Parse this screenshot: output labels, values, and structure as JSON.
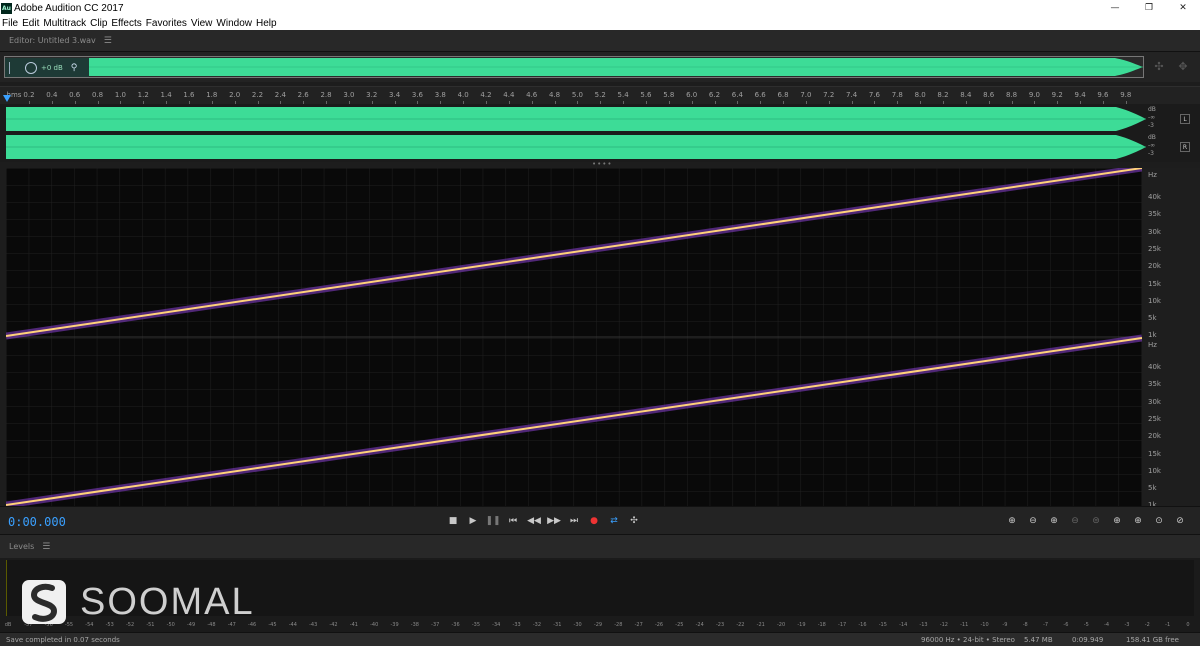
{
  "window": {
    "title": "Adobe Audition CC 2017",
    "app_icon": "Au",
    "controls": {
      "minimize": "—",
      "maximize": "❐",
      "close": "✕"
    }
  },
  "menu": [
    "File",
    "Edit",
    "Multitrack",
    "Clip",
    "Effects",
    "Favorites",
    "View",
    "Window",
    "Help"
  ],
  "editor": {
    "title": "Editor: Untitled 3.wav"
  },
  "hud": {
    "gain": "+0 dB"
  },
  "ruler": {
    "unit": "hms",
    "labels": [
      "0.2",
      "0.4",
      "0.6",
      "0.8",
      "1.0",
      "1.2",
      "1.4",
      "1.6",
      "1.8",
      "2.0",
      "2.2",
      "2.4",
      "2.6",
      "2.8",
      "3.0",
      "3.2",
      "3.4",
      "3.6",
      "3.8",
      "4.0",
      "4.2",
      "4.4",
      "4.6",
      "4.8",
      "5.0",
      "5.2",
      "5.4",
      "5.6",
      "5.8",
      "6.0",
      "6.2",
      "6.4",
      "6.6",
      "6.8",
      "7.0",
      "7.2",
      "7.4",
      "7.6",
      "7.8",
      "8.0",
      "8.2",
      "8.4",
      "8.6",
      "8.8",
      "9.0",
      "9.2",
      "9.4",
      "9.6",
      "9.8"
    ]
  },
  "waveform": {
    "scale_top": "dB",
    "scale_mid": "-∞",
    "scale_bottom": "-3",
    "channels": [
      "L",
      "R"
    ],
    "color": "#3ddc97"
  },
  "spectral": {
    "unit": "Hz",
    "freq_labels": [
      "40k",
      "35k",
      "30k",
      "25k",
      "20k",
      "15k",
      "10k",
      "5k",
      "1k"
    ],
    "sweep_color": "#ffd27a",
    "glow_color": "#8a3fd1"
  },
  "transport": {
    "time": "0:00.000",
    "buttons": [
      "■",
      "▶",
      "❚❚",
      "⏮",
      "◀◀",
      "▶▶",
      "⏭",
      "●",
      "⇄",
      "✣"
    ]
  },
  "levels": {
    "title": "Levels",
    "scale": [
      "dB",
      "-57",
      "-56",
      "-55",
      "-54",
      "-53",
      "-52",
      "-51",
      "-50",
      "-49",
      "-48",
      "-47",
      "-46",
      "-45",
      "-44",
      "-43",
      "-42",
      "-41",
      "-40",
      "-39",
      "-38",
      "-37",
      "-36",
      "-35",
      "-34",
      "-33",
      "-32",
      "-31",
      "-30",
      "-29",
      "-28",
      "-27",
      "-26",
      "-25",
      "-24",
      "-23",
      "-22",
      "-21",
      "-20",
      "-19",
      "-18",
      "-17",
      "-16",
      "-15",
      "-14",
      "-13",
      "-12",
      "-11",
      "-10",
      "-9",
      "-8",
      "-7",
      "-6",
      "-5",
      "-4",
      "-3",
      "-2",
      "-1",
      "0"
    ]
  },
  "watermark": {
    "text": "SOOMAL"
  },
  "status": {
    "message": "Save completed in 0.07 seconds",
    "format": "96000 Hz • 24-bit • Stereo",
    "size": "5.47 MB",
    "duration": "0:09.949",
    "free": "158.41 GB free"
  }
}
